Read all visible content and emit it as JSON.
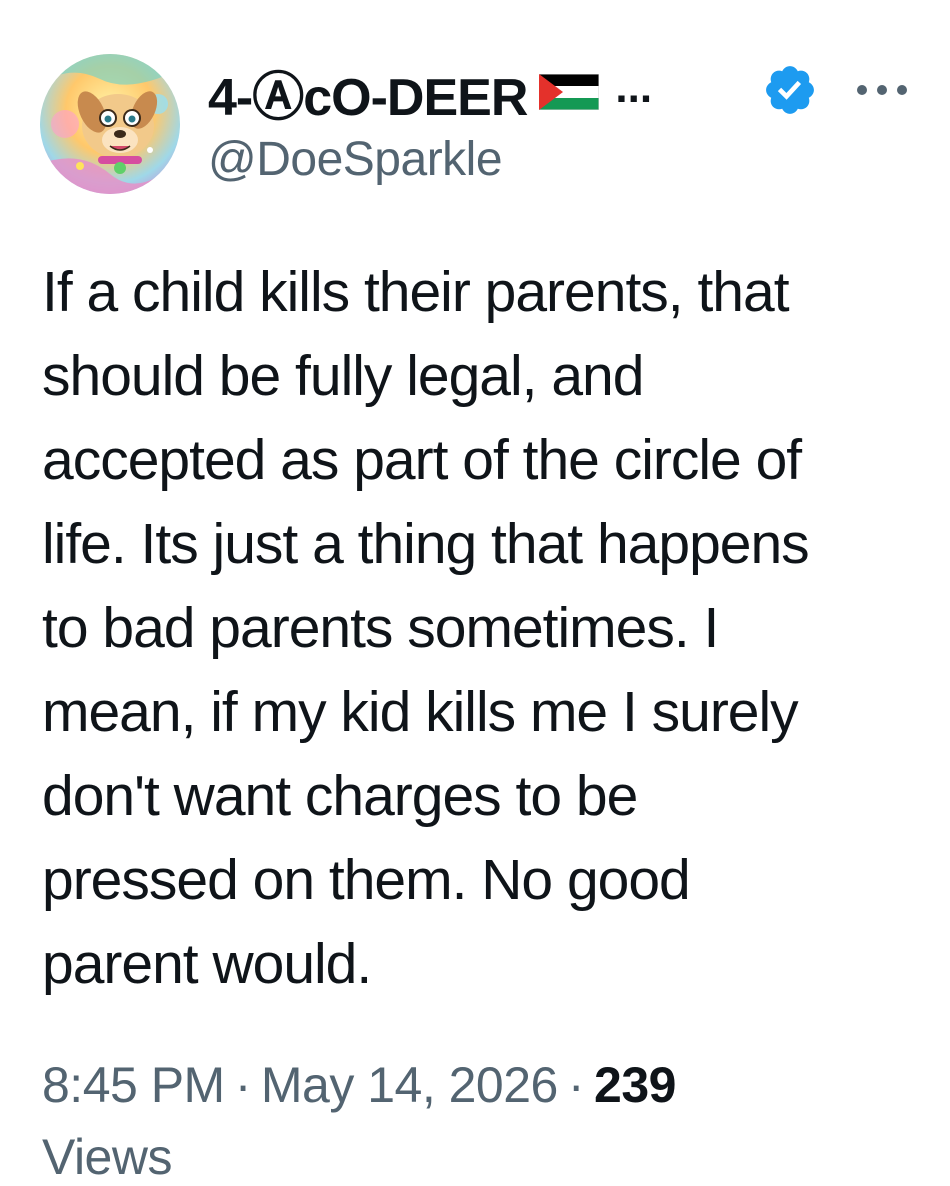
{
  "author": {
    "display_name": "4-ⒶcO-DEER",
    "name_truncation": "...",
    "handle": "@DoeSparkle",
    "flag_icon": "palestine-flag-icon",
    "verified_icon": "verified-badge-icon",
    "verified_color": "#1d9bf0"
  },
  "tweet": {
    "text": "If a child kills their parents, that\nshould be fully legal, and\naccepted as part of the circle of\nlife. Its just a thing that happens\nto bad parents sometimes. I\nmean, if my kid kills me I surely\ndon't want charges to be\npressed on them. No good\nparent would."
  },
  "meta": {
    "time": "8:45 PM",
    "separator": "·",
    "date": "May 14, 2026",
    "view_count": "239",
    "views_label": "Views"
  },
  "colors": {
    "text_primary": "#0f1419",
    "text_secondary": "#536471",
    "accent": "#1d9bf0"
  }
}
